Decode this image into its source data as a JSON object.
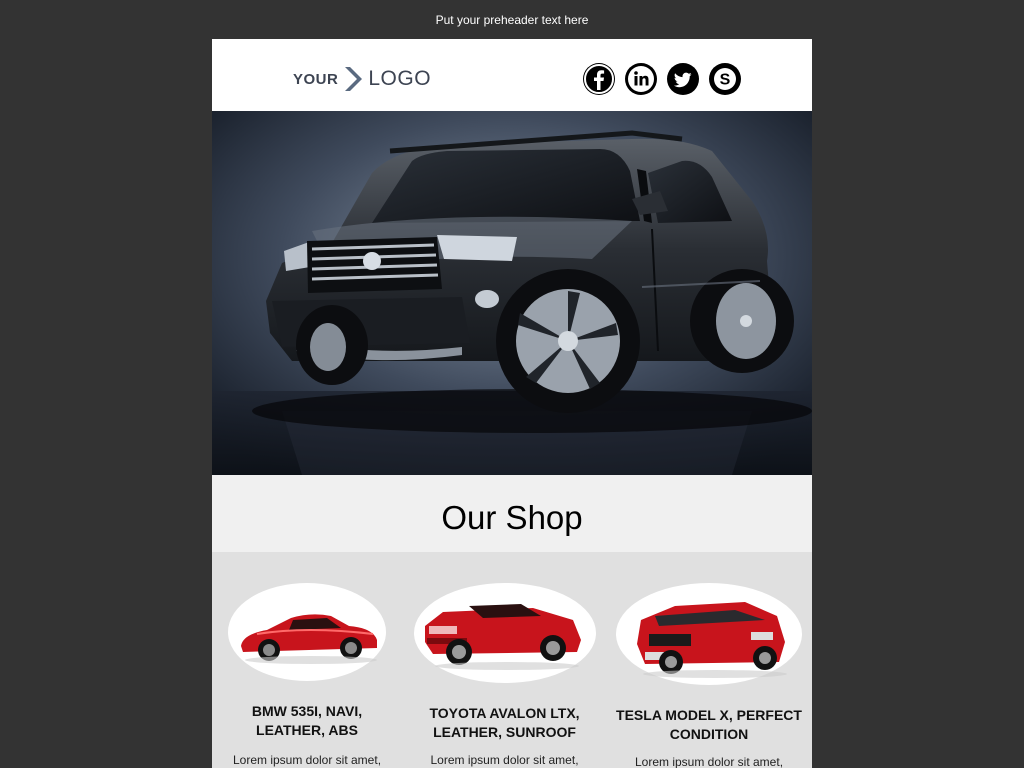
{
  "preheader": "Put your preheader text here",
  "logo": {
    "part1": "YOUR",
    "part2": "LOGO",
    "chevron_color": "#5a6a80"
  },
  "social": [
    {
      "name": "facebook-icon",
      "glyph": "f"
    },
    {
      "name": "linkedin-icon",
      "glyph": "in"
    },
    {
      "name": "twitter-icon",
      "glyph": "bird"
    },
    {
      "name": "skype-icon",
      "glyph": "S"
    }
  ],
  "shop": {
    "title": "Our Shop"
  },
  "products": [
    {
      "name": "BMW 535I, NAVI, LEATHER, ABS",
      "desc": "Lorem ipsum dolor sit amet,"
    },
    {
      "name": "TOYOTA AVALON LTX, LEATHER, SUNROOF",
      "desc": "Lorem ipsum dolor sit amet,"
    },
    {
      "name": "TESLA MODEL X, PERFECT CONDITION",
      "desc": "Lorem ipsum dolor sit amet,"
    }
  ],
  "colors": {
    "background": "#333333",
    "accent_red": "#c8141c",
    "band_light": "#f0f0f0",
    "band_gray": "#e0e0e0"
  }
}
